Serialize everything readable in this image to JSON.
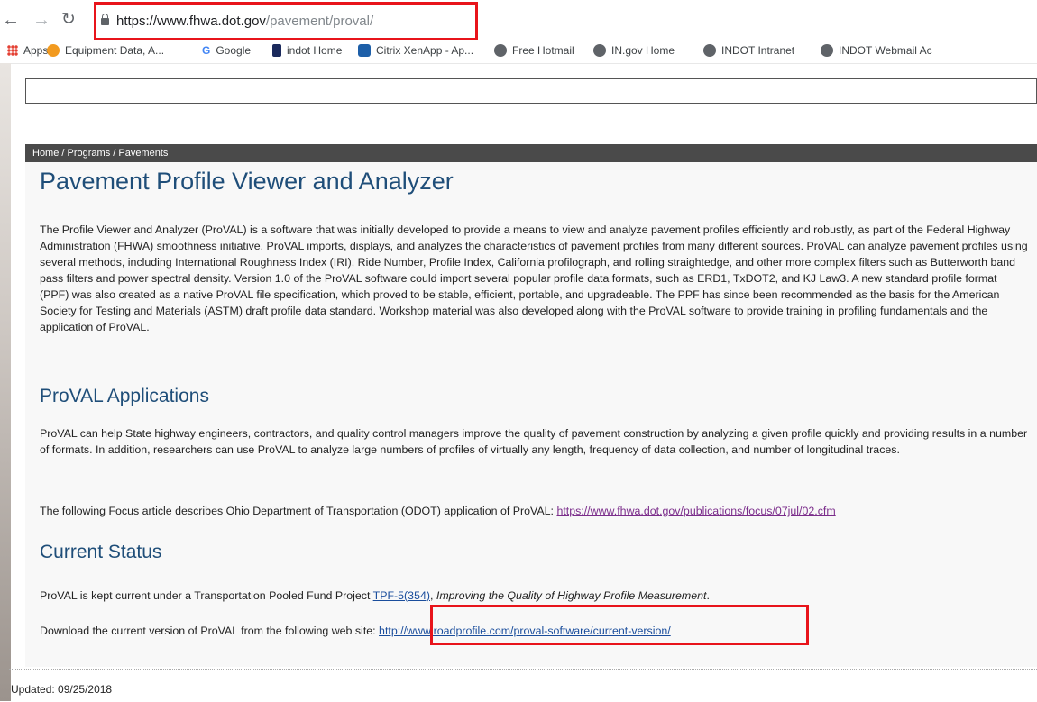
{
  "browser": {
    "back_icon": "arrow-left-icon",
    "forward_icon": "arrow-right-icon",
    "reload_icon": "reload-icon",
    "url_host": "https://www.fhwa.dot.gov",
    "url_path": "/pavement/proval/",
    "bookmarks": [
      {
        "label": "Apps",
        "icon": "apps-grid-icon",
        "color": "#e44134"
      },
      {
        "label": "Equipment Data, A...",
        "icon": "flower-icon",
        "color": "#f29a1f"
      },
      {
        "label": "Google",
        "icon": "google-icon",
        "color": "#4285f4"
      },
      {
        "label": "indot Home",
        "icon": "indot-icon",
        "color": "#1b2a5c"
      },
      {
        "label": "Citrix XenApp - Ap...",
        "icon": "citrix-icon",
        "color": "#1d5fa8"
      },
      {
        "label": "Free Hotmail",
        "icon": "globe-icon",
        "color": "#5f6368"
      },
      {
        "label": "IN.gov Home",
        "icon": "globe-icon",
        "color": "#5f6368"
      },
      {
        "label": "INDOT Intranet",
        "icon": "globe-icon",
        "color": "#5f6368"
      },
      {
        "label": "INDOT Webmail Ac",
        "icon": "globe-icon",
        "color": "#5f6368"
      }
    ],
    "highlight_color": "#e8141b"
  },
  "page": {
    "breadcrumb": "Home / Programs / Pavements",
    "title": "Pavement Profile Viewer and Analyzer",
    "intro": "The Profile Viewer and Analyzer (ProVAL) is a software that was initially developed to provide a means to view and analyze pavement profiles efficiently and robustly, as part of the Federal Highway Administration (FHWA) smoothness initiative. ProVAL imports, displays, and analyzes the characteristics of pavement profiles from many different sources. ProVAL can analyze pavement profiles using several methods, including International Roughness Index (IRI), Ride Number, Profile Index, California profilograph, and rolling straightedge, and other more complex filters such as Butterworth band pass filters and power spectral density. Version 1.0 of the ProVAL software could import several popular profile data formats, such as ERD1, TxDOT2, and KJ Law3. A new standard profile format (PPF) was also created as a native ProVAL file specification, which proved to be stable, efficient, portable, and upgradeable. The PPF has since been recommended as the basis for the American Society for Testing and Materials (ASTM) draft profile data standard. Workshop material was also developed along with the ProVAL software to provide training in profiling fundamentals and the application of ProVAL.",
    "applications_heading": "ProVAL Applications",
    "applications_text": "ProVAL can help State highway engineers, contractors, and quality control managers improve the quality of pavement construction by analyzing a given profile quickly and providing results in a number of formats. In addition, researchers can use ProVAL to analyze large numbers of profiles of virtually any length, frequency of data collection, and number of longitudinal traces.",
    "focus_text": "The following Focus article describes Ohio Department of Transportation (ODOT) application of ProVAL: ",
    "focus_link": "https://www.fhwa.dot.gov/publications/focus/07jul/02.cfm",
    "status_heading": "Current Status",
    "status_text_pre": "ProVAL is kept current under a Transportation Pooled Fund Project ",
    "status_link": "TPF-5(354)",
    "status_text_italic": "Improving the Quality of Highway Profile Measurement",
    "status_text_post": ".",
    "download_text": "Download the current version of ProVAL from the following web site: ",
    "download_link": "http://www.roadprofile.com/proval-software/current-version/",
    "updated": "Updated: 09/25/2018"
  }
}
